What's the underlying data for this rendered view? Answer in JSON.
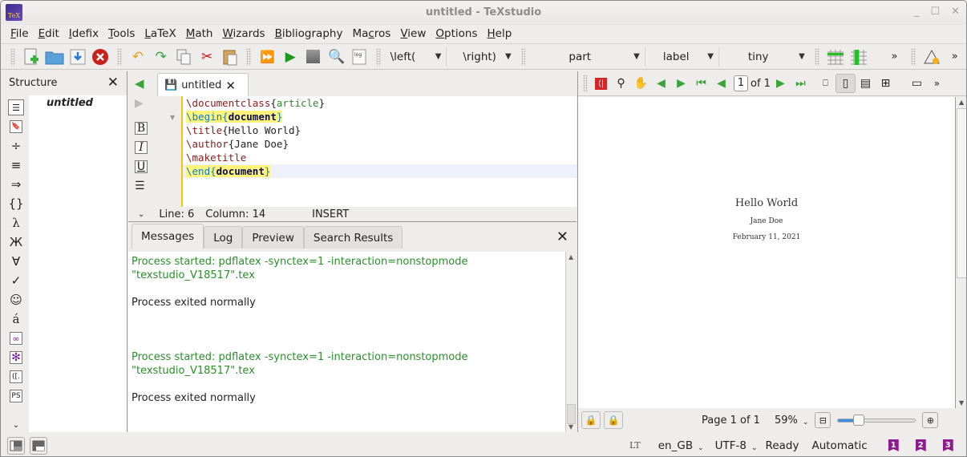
{
  "window": {
    "title": "untitled - TeXstudio",
    "app_icon": "TeX"
  },
  "menubar": [
    {
      "label": "File",
      "u": "F",
      "rest": "ile"
    },
    {
      "label": "Edit",
      "u": "E",
      "rest": "dit"
    },
    {
      "label": "Idefix",
      "u": "I",
      "rest": "defix"
    },
    {
      "label": "Tools",
      "u": "T",
      "rest": "ools"
    },
    {
      "label": "LaTeX",
      "u": "L",
      "rest": "aTeX"
    },
    {
      "label": "Math",
      "u": "M",
      "rest": "ath"
    },
    {
      "label": "Wizards",
      "u": "W",
      "rest": "izards"
    },
    {
      "label": "Bibliography",
      "u": "B",
      "rest": "ibliography"
    },
    {
      "label": "Macros",
      "pre": "Ma",
      "u": "c",
      "rest": "ros"
    },
    {
      "label": "View",
      "u": "V",
      "rest": "iew"
    },
    {
      "label": "Options",
      "u": "O",
      "rest": "ptions"
    },
    {
      "label": "Help",
      "u": "H",
      "rest": "elp"
    }
  ],
  "toolbar": {
    "left_delim": "\\left(",
    "right_delim": "\\right)",
    "section": "part",
    "ref": "label",
    "size": "tiny",
    "more": "»"
  },
  "structure": {
    "title": "Structure",
    "root": "untitled"
  },
  "editor": {
    "tab_label": "untitled",
    "lines": [
      {
        "cmd": "\\documentclass",
        "open": "{",
        "arg": "article",
        "close": "}"
      },
      {
        "cmd": "\\begin",
        "open": "{",
        "arg": "document",
        "close": "}"
      },
      {
        "cmd": "\\title",
        "open": "{",
        "arg": "Hello World",
        "close": "}"
      },
      {
        "cmd": "\\author",
        "open": "{",
        "arg": "Jane Doe",
        "close": "}"
      },
      {
        "cmd": "\\maketitle",
        "open": "",
        "arg": "",
        "close": ""
      },
      {
        "cmd": "\\end",
        "open": "{",
        "arg": "document",
        "close": "}"
      }
    ],
    "status": {
      "line": "Line: 6",
      "column": "Column: 14",
      "mode": "INSERT"
    }
  },
  "messages": {
    "tabs": [
      "Messages",
      "Log",
      "Preview",
      "Search Results"
    ],
    "active_tab": "Messages",
    "entries": [
      {
        "l1": "Process started: pdflatex -synctex=1 -interaction=nonstopmode",
        "l2": "\"texstudio_V18517\".tex",
        "result": "Process exited normally"
      },
      {
        "l1": "Process started: pdflatex -synctex=1 -interaction=nonstopmode",
        "l2": "\"texstudio_V18517\".tex",
        "result": "Process exited normally"
      }
    ]
  },
  "pdf": {
    "page_input": "1",
    "of_label": "of 1",
    "doc_title": "Hello World",
    "doc_author": "Jane Doe",
    "doc_date": "February 11, 2021",
    "page_status": "Page 1 of 1",
    "zoom": "59%",
    "zoom_slider_fraction": 0.27
  },
  "statusbar": {
    "lt": "LT",
    "language": "en_GB",
    "encoding": "UTF-8",
    "state": "Ready",
    "mode": "Automatic",
    "bookmarks": [
      "1",
      "2",
      "3"
    ]
  },
  "colors": {
    "accent_green": "#2a8f2a",
    "bookmark_purple": "#8e1b8e",
    "highlight_yellow": "#fff57a"
  }
}
